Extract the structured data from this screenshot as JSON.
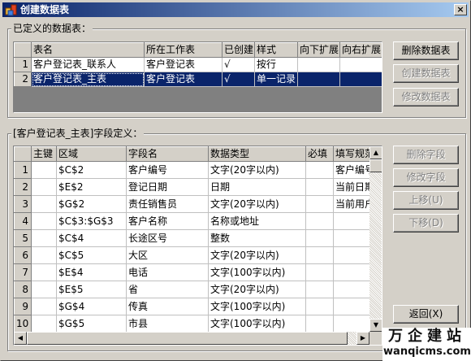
{
  "window": {
    "title": "创建数据表",
    "close_glyph": "×"
  },
  "defined_tables": {
    "group_label": "已定义的数据表：",
    "columns": [
      "表名",
      "所在工作表",
      "已创建",
      "样式",
      "向下扩展",
      "向右扩展"
    ],
    "rows": [
      {
        "num": "1",
        "name": "客户登记表_联系人",
        "sheet": "客户登记表",
        "created": "√",
        "style": "按行",
        "down": "",
        "right": "",
        "selected": false
      },
      {
        "num": "2",
        "name": "客户登记表_主表",
        "sheet": "客户登记表",
        "created": "√",
        "style": "单一记录",
        "down": "",
        "right": "",
        "selected": true
      }
    ],
    "buttons": {
      "delete": "删除数据表",
      "create": "创建数据表",
      "modify": "修改数据表"
    }
  },
  "fields": {
    "group_label": "[客户登记表_主表]字段定义：",
    "columns": [
      "主键",
      "区域",
      "字段名",
      "数据类型",
      "必填",
      "填写规范"
    ],
    "rows": [
      {
        "num": "1",
        "pk": "",
        "area": "$C$2",
        "field": "客户编号",
        "type": "文字(20字以内)",
        "required": "",
        "rule": "客户编号"
      },
      {
        "num": "2",
        "pk": "",
        "area": "$E$2",
        "field": "登记日期",
        "type": "日期",
        "required": "",
        "rule": "当前日期"
      },
      {
        "num": "3",
        "pk": "",
        "area": "$G$2",
        "field": "责任销售员",
        "type": "文字(20字以内)",
        "required": "",
        "rule": "当前用户"
      },
      {
        "num": "4",
        "pk": "",
        "area": "$C$3:$G$3",
        "field": "客户名称",
        "type": "名称或地址",
        "required": "",
        "rule": ""
      },
      {
        "num": "5",
        "pk": "",
        "area": "$C$4",
        "field": "长途区号",
        "type": "整数",
        "required": "",
        "rule": ""
      },
      {
        "num": "6",
        "pk": "",
        "area": "$C$5",
        "field": "大区",
        "type": "文字(20字以内)",
        "required": "",
        "rule": ""
      },
      {
        "num": "7",
        "pk": "",
        "area": "$E$4",
        "field": "电话",
        "type": "文字(100字以内)",
        "required": "",
        "rule": ""
      },
      {
        "num": "8",
        "pk": "",
        "area": "$E$5",
        "field": "省",
        "type": "文字(20字以内)",
        "required": "",
        "rule": ""
      },
      {
        "num": "9",
        "pk": "",
        "area": "$G$4",
        "field": "传真",
        "type": "文字(100字以内)",
        "required": "",
        "rule": ""
      },
      {
        "num": "10",
        "pk": "",
        "area": "$G$5",
        "field": "市县",
        "type": "文字(100字以内)",
        "required": "",
        "rule": ""
      }
    ],
    "buttons": {
      "delete": "删除字段",
      "modify": "修改字段",
      "up": "上移(U)",
      "down": "下移(D)",
      "back": "返回(X)"
    }
  },
  "watermark": {
    "cn": "万企建站",
    "en": "wanqicms.com"
  }
}
